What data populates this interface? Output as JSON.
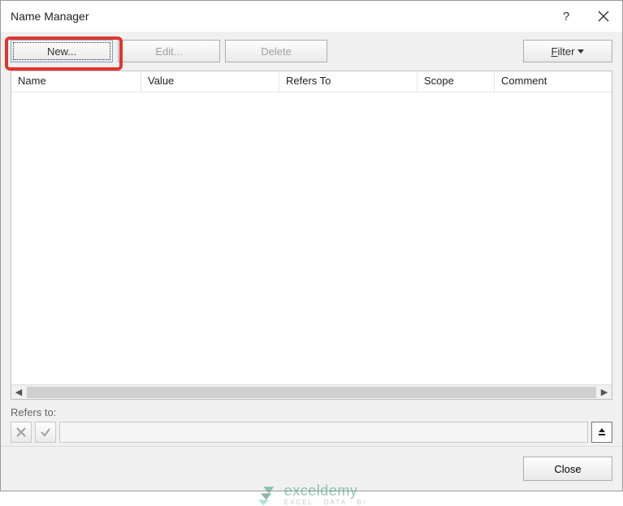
{
  "titlebar": {
    "title": "Name Manager"
  },
  "toolbar": {
    "new_label": "New...",
    "edit_label": "Edit...",
    "delete_label": "Delete",
    "filter_label": "Filter"
  },
  "columns": {
    "name": "Name",
    "value": "Value",
    "refers_to": "Refers To",
    "scope": "Scope",
    "comment": "Comment"
  },
  "refers": {
    "label": "Refers to:",
    "value": ""
  },
  "footer": {
    "close_label": "Close"
  },
  "watermark": {
    "brand": "exceldemy",
    "tagline": "EXCEL · DATA · BI"
  }
}
